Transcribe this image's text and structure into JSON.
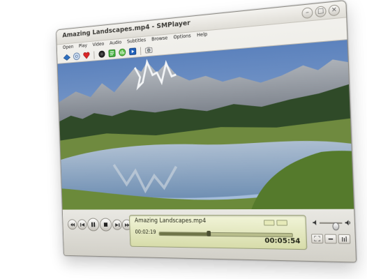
{
  "window": {
    "title": "Amazing Landscapes.mp4 - SMPlayer",
    "controls": [
      "minimize",
      "maximize",
      "close"
    ]
  },
  "menubar": {
    "items": [
      {
        "label": "Open",
        "mnemonic": "O"
      },
      {
        "label": "Play",
        "mnemonic": "P"
      },
      {
        "label": "Video",
        "mnemonic": "V"
      },
      {
        "label": "Audio",
        "mnemonic": "A"
      },
      {
        "label": "Subtitles",
        "mnemonic": "S"
      },
      {
        "label": "Browse",
        "mnemonic": "B"
      },
      {
        "label": "Options",
        "mnemonic": "O"
      },
      {
        "label": "Help",
        "mnemonic": "H"
      }
    ]
  },
  "toolbar": {
    "icons": [
      "open-file-icon",
      "open-disc-icon",
      "favorites-icon",
      "record-icon",
      "playlist-icon",
      "equalizer-icon",
      "video-preferences-icon",
      "screenshot-icon"
    ]
  },
  "video": {
    "scene": "mountain-lake-landscape",
    "colors": {
      "sky": "#7b9bc7",
      "mountain": "#8a8f98",
      "forest": "#2f4a28",
      "meadow": "#6f8a3f",
      "water": "#8fa9c6"
    }
  },
  "player": {
    "filename": "Amazing Landscapes.mp4",
    "elapsed": "00:02:19",
    "total": "00:05:54",
    "progress": 0.39,
    "volume": 0.7
  },
  "buttons": {
    "rewind": "rewind-icon",
    "previous": "skip-back-icon",
    "pause": "pause-icon",
    "stop": "stop-icon",
    "next": "skip-forward-icon",
    "forward": "fast-forward-icon",
    "fullscreen": "fullscreen-icon",
    "compact": "compact-mode-icon",
    "equalizer": "equalizer-icon",
    "speaker_low": "volume-low-icon",
    "speaker_high": "volume-high-icon"
  }
}
